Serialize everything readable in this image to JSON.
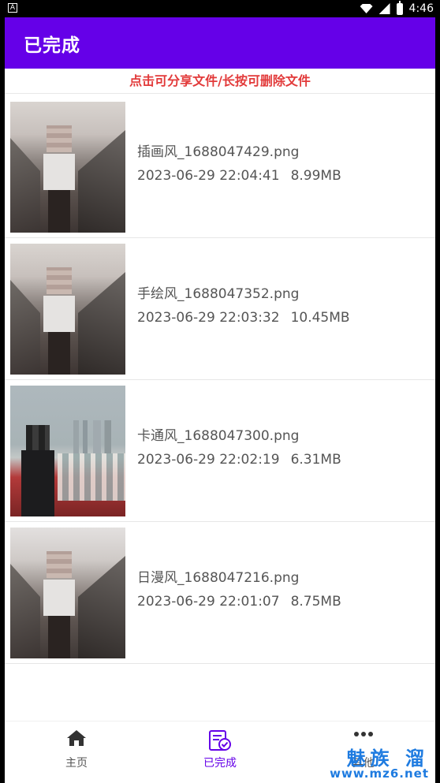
{
  "status_bar": {
    "left_badge": "A",
    "time": "4:46"
  },
  "header": {
    "title": "已完成"
  },
  "hint": "点击可分享文件/长按可删除文件",
  "files": [
    {
      "name": "插画风_1688047429.png",
      "datetime": "2023-06-29 22:04:41",
      "size": "8.99MB"
    },
    {
      "name": "手绘风_1688047352.png",
      "datetime": "2023-06-29 22:03:32",
      "size": "10.45MB"
    },
    {
      "name": "卡通风_1688047300.png",
      "datetime": "2023-06-29 22:02:19",
      "size": "6.31MB"
    },
    {
      "name": "日漫风_1688047216.png",
      "datetime": "2023-06-29 22:01:07",
      "size": "8.75MB"
    }
  ],
  "bottom_nav": {
    "items": [
      {
        "label": "主页",
        "icon": "home-icon"
      },
      {
        "label": "已完成",
        "icon": "completed-list-icon"
      },
      {
        "label": "其他",
        "icon": "more-icon"
      }
    ],
    "active_index": 1,
    "active_color": "#6500e8"
  },
  "watermark": {
    "brand": "魅族 溜",
    "site": "www.mz6.net"
  },
  "colors": {
    "primary": "#6500e8",
    "hint": "#e23a3a"
  }
}
